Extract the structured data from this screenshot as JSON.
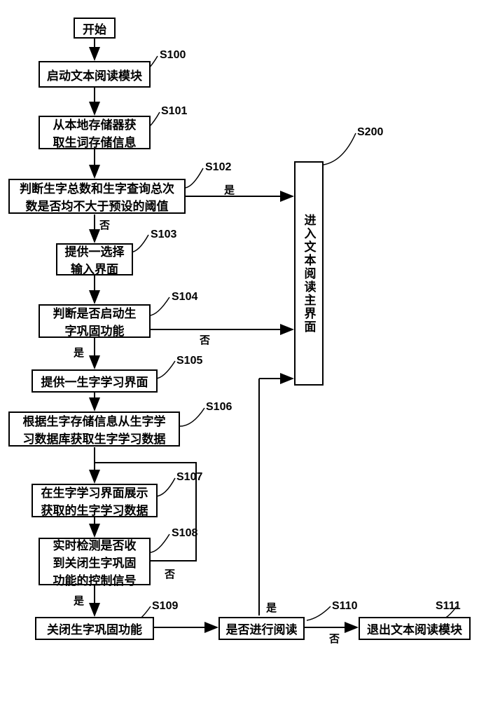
{
  "nodes": {
    "start": "开始",
    "s100": "启动文本阅读模块",
    "s101": "从本地存储器获\n取生词存储信息",
    "s102": "判断生字总数和生字查询总次\n数是否均不大于预设的阈值",
    "s103": "提供一选择\n输入界面",
    "s104": "判断是否启动生\n字巩固功能",
    "s105": "提供一生字学习界面",
    "s106": "根据生字存储信息从生字学\n习数据库获取生字学习数据",
    "s107": "在生字学习界面展示\n获取的生字学习数据",
    "s108": "实时检测是否收\n到关闭生字巩固\n功能的控制信号",
    "s109": "关闭生字巩固功能",
    "s110": "是否进行阅读",
    "s111": "退出文本阅读模块",
    "s200": "进入文本阅读主界面"
  },
  "step_labels": {
    "s100": "S100",
    "s101": "S101",
    "s102": "S102",
    "s103": "S103",
    "s104": "S104",
    "s105": "S105",
    "s106": "S106",
    "s107": "S107",
    "s108": "S108",
    "s109": "S109",
    "s110": "S110",
    "s111": "S111",
    "s200": "S200"
  },
  "edge_labels": {
    "yes": "是",
    "no": "否"
  }
}
